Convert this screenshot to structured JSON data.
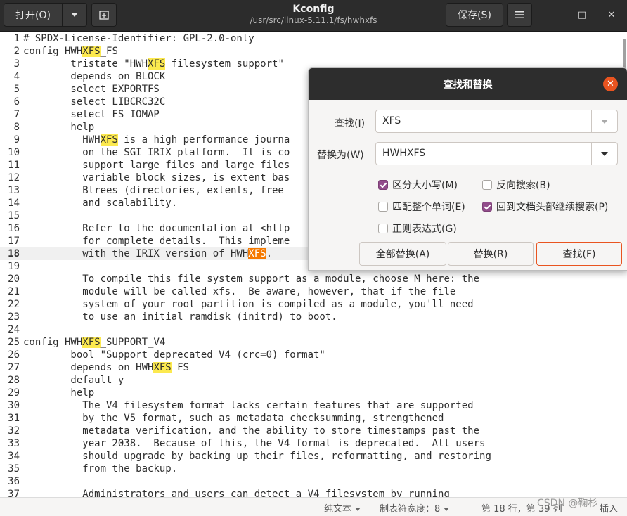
{
  "header": {
    "open_label": "打开(O)",
    "open_dropdown_icon": "chevron-down-icon",
    "new_tab_icon": "new-tab-icon",
    "title": "Kconfig",
    "subtitle": "/usr/src/linux-5.11.1/fs/hwhxfs",
    "save_label": "保存(S)",
    "menu_icon": "hamburger-menu-icon",
    "minimize_glyph": "—",
    "maximize_glyph": "□",
    "close_glyph": "✕"
  },
  "editor": {
    "current_line": 18,
    "lines": [
      {
        "n": "1",
        "parts": [
          {
            "t": "# SPDX-License-Identifier: GPL-2.0-only"
          }
        ]
      },
      {
        "n": "2",
        "parts": [
          {
            "t": "config HWH"
          },
          {
            "t": "XFS",
            "h": 1
          },
          {
            "t": "_FS"
          }
        ]
      },
      {
        "n": "3",
        "parts": [
          {
            "t": "        tristate \"HWH"
          },
          {
            "t": "XFS",
            "h": 1
          },
          {
            "t": " filesystem support\""
          }
        ]
      },
      {
        "n": "4",
        "parts": [
          {
            "t": "        depends on BLOCK"
          }
        ]
      },
      {
        "n": "5",
        "parts": [
          {
            "t": "        select EXPORTFS"
          }
        ]
      },
      {
        "n": "6",
        "parts": [
          {
            "t": "        select LIBCRC32C"
          }
        ]
      },
      {
        "n": "7",
        "parts": [
          {
            "t": "        select FS_IOMAP"
          }
        ]
      },
      {
        "n": "8",
        "parts": [
          {
            "t": "        help"
          }
        ]
      },
      {
        "n": "9",
        "parts": [
          {
            "t": "          HWH"
          },
          {
            "t": "XFS",
            "h": 1
          },
          {
            "t": " is a high performance journa"
          }
        ]
      },
      {
        "n": "10",
        "parts": [
          {
            "t": "          on the SGI IRIX platform.  It is co"
          }
        ]
      },
      {
        "n": "11",
        "parts": [
          {
            "t": "          support large files and large files"
          }
        ]
      },
      {
        "n": "12",
        "parts": [
          {
            "t": "          variable block sizes, is extent bas"
          }
        ]
      },
      {
        "n": "13",
        "parts": [
          {
            "t": "          Btrees (directories, extents, free "
          }
        ]
      },
      {
        "n": "14",
        "parts": [
          {
            "t": "          and scalability."
          }
        ]
      },
      {
        "n": "15",
        "parts": [
          {
            "t": ""
          }
        ]
      },
      {
        "n": "16",
        "parts": [
          {
            "t": "          Refer to the documentation at <http"
          }
        ]
      },
      {
        "n": "17",
        "parts": [
          {
            "t": "          for complete details.  This impleme"
          }
        ]
      },
      {
        "n": "18",
        "parts": [
          {
            "t": "          with the IRIX version of HWH"
          },
          {
            "t": "XFS",
            "h": 2
          },
          {
            "t": "."
          }
        ]
      },
      {
        "n": "19",
        "parts": [
          {
            "t": ""
          }
        ]
      },
      {
        "n": "20",
        "parts": [
          {
            "t": "          To compile this file system support as a module, choose M here: the"
          }
        ]
      },
      {
        "n": "21",
        "parts": [
          {
            "t": "          module will be called xfs.  Be aware, however, that if the file"
          }
        ]
      },
      {
        "n": "22",
        "parts": [
          {
            "t": "          system of your root partition is compiled as a module, you'll need"
          }
        ]
      },
      {
        "n": "23",
        "parts": [
          {
            "t": "          to use an initial ramdisk (initrd) to boot."
          }
        ]
      },
      {
        "n": "24",
        "parts": [
          {
            "t": ""
          }
        ]
      },
      {
        "n": "25",
        "parts": [
          {
            "t": "config HWH"
          },
          {
            "t": "XFS",
            "h": 1
          },
          {
            "t": "_SUPPORT_V4"
          }
        ]
      },
      {
        "n": "26",
        "parts": [
          {
            "t": "        bool \"Support deprecated V4 (crc=0) format\""
          }
        ]
      },
      {
        "n": "27",
        "parts": [
          {
            "t": "        depends on HWH"
          },
          {
            "t": "XFS",
            "h": 1
          },
          {
            "t": "_FS"
          }
        ]
      },
      {
        "n": "28",
        "parts": [
          {
            "t": "        default y"
          }
        ]
      },
      {
        "n": "29",
        "parts": [
          {
            "t": "        help"
          }
        ]
      },
      {
        "n": "30",
        "parts": [
          {
            "t": "          The V4 filesystem format lacks certain features that are supported"
          }
        ]
      },
      {
        "n": "31",
        "parts": [
          {
            "t": "          by the V5 format, such as metadata checksumming, strengthened"
          }
        ]
      },
      {
        "n": "32",
        "parts": [
          {
            "t": "          metadata verification, and the ability to store timestamps past the"
          }
        ]
      },
      {
        "n": "33",
        "parts": [
          {
            "t": "          year 2038.  Because of this, the V4 format is deprecated.  All users"
          }
        ]
      },
      {
        "n": "34",
        "parts": [
          {
            "t": "          should upgrade by backing up their files, reformatting, and restoring"
          }
        ]
      },
      {
        "n": "35",
        "parts": [
          {
            "t": "          from the backup."
          }
        ]
      },
      {
        "n": "36",
        "parts": [
          {
            "t": ""
          }
        ]
      },
      {
        "n": "37",
        "parts": [
          {
            "t": "          Administrators and users can detect a V4 filesystem by running"
          }
        ]
      }
    ]
  },
  "dialog": {
    "title": "查找和替换",
    "close_icon": "close-icon",
    "find_label": "查找(I)",
    "find_value": "XFS",
    "replace_label": "替换为(W)",
    "replace_value": "HWHXFS",
    "options": {
      "match_case": {
        "label": "区分大小写(M)",
        "checked": true
      },
      "backwards": {
        "label": "反向搜索(B)",
        "checked": false
      },
      "whole_word": {
        "label": "匹配整个单词(E)",
        "checked": false
      },
      "wrap_around": {
        "label": "回到文档头部继续搜索(P)",
        "checked": true
      },
      "regex": {
        "label": "正则表达式(G)",
        "checked": false
      }
    },
    "replace_all_label": "全部替换(A)",
    "replace_label_btn": "替换(R)",
    "find_btn_label": "查找(F)"
  },
  "status": {
    "language": "纯文本",
    "tab_width": "制表符宽度：8",
    "position": "第 18 行，第 39 列",
    "mode": "插入",
    "watermark": "CSDN @鞠杉"
  }
}
